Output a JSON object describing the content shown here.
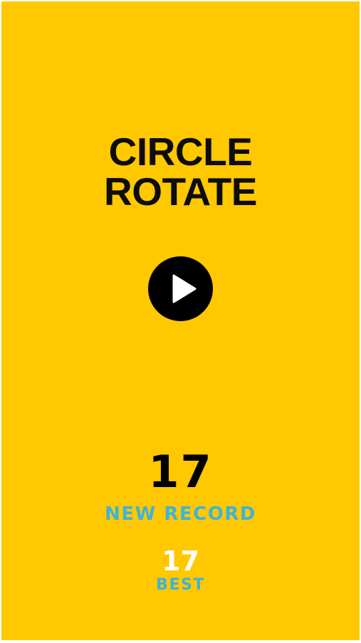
{
  "game": {
    "title_line1": "CIRCLE",
    "title_line2": "ROTATE",
    "score": "17",
    "record_label": "NEW RECORD",
    "best_score": "17",
    "best_label": "BEST"
  },
  "icons": {
    "play": "play-icon"
  },
  "colors": {
    "background": "#FFC800",
    "title": "#0d0d0d",
    "play_button": "#000000",
    "play_glyph": "#ffffff",
    "score": "#000000",
    "label": "#3FB3D8",
    "best_score": "#ffffff"
  }
}
